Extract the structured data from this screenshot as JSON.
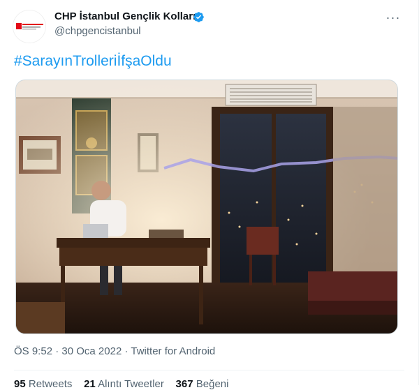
{
  "tweet": {
    "display_name": "CHP İstanbul Gençlik Kolları",
    "handle": "@chpgencistanbul",
    "more_label": "···",
    "hashtag": "#SarayınTrolleriİfşaOldu",
    "time": "ÖS 9:52",
    "date": "30 Oca 2022",
    "separator": "·",
    "source": "Twitter for Android",
    "stats": {
      "retweets_count": "95",
      "retweets_label": "Retweets",
      "quotes_count": "21",
      "quotes_label": "Alıntı Tweetler",
      "likes_count": "367",
      "likes_label": "Beğeni"
    }
  },
  "colors": {
    "link": "#1d9bf0",
    "secondary_text": "#536471",
    "primary_text": "#0f1419",
    "verified": "#1d9bf0"
  },
  "icons": {
    "verified": "verified-badge-icon",
    "more": "more-dots-icon",
    "avatar_logo": "chp-gencik-logo"
  }
}
